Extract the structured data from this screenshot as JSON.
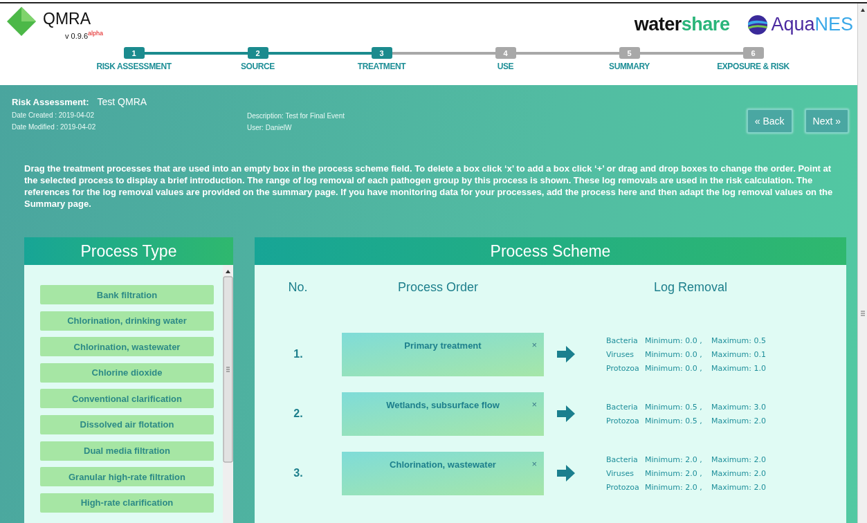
{
  "app": {
    "name": "QMRA",
    "version": "v 0.9.6",
    "version_tag": "alpha"
  },
  "partner_logos": [
    {
      "kind": "watershare",
      "parts": [
        "water",
        "share"
      ]
    },
    {
      "kind": "aquanes",
      "parts": [
        "Aqua",
        "NES"
      ]
    }
  ],
  "steps": [
    {
      "number": "1",
      "label": "RISK ASSESSMENT",
      "done": true
    },
    {
      "number": "2",
      "label": "SOURCE",
      "done": true
    },
    {
      "number": "3",
      "label": "TREATMENT",
      "done": true
    },
    {
      "number": "4",
      "label": "USE",
      "done": false
    },
    {
      "number": "5",
      "label": "SUMMARY",
      "done": false
    },
    {
      "number": "6",
      "label": "EXPOSURE & RISK",
      "done": false
    }
  ],
  "assessment": {
    "label": "Risk Assessment:",
    "name": "Test QMRA",
    "date_created": "Date Created : 2019-04-02",
    "date_modified": "Date Modified : 2019-04-02",
    "description": "Description: Test for Final Event",
    "user": "User: DanielW"
  },
  "nav_buttons": [
    "« Back",
    "Next »"
  ],
  "instructions": "Drag the treatment processes that are used into an empty box in the process scheme field. To delete a box click ‘x’ to add a box click ‘+’ or drag and drop boxes to change the order. Point at the selected process to display a brief introduction. The range of log removal of each pathogen group by this process is shown. These log removals are used in the risk calculation. The references for the log removal values are provided on the summary page. If you have monitoring data for your processes, add the process here and then adapt the log removal values on the Summary page.",
  "process_type": {
    "title": "Process Type",
    "items": [
      "Bank filtration",
      "Chlorination, drinking water",
      "Chlorination, wastewater",
      "Chlorine dioxide",
      "Conventional clarification",
      "Dissolved air flotation",
      "Dual media filtration",
      "Granular high-rate filtration",
      "High-rate clarification"
    ]
  },
  "process_scheme": {
    "title": "Process Scheme",
    "columns": [
      "No.",
      "Process Order",
      "Log Removal"
    ],
    "rows": [
      {
        "number": "1.",
        "process": "Primary treatment",
        "remove": "×",
        "removals": [
          {
            "pathogen": "Bacteria",
            "minimum": "Minimum: 0.0 ,",
            "maximum": "Maximum: 0.5"
          },
          {
            "pathogen": "Viruses",
            "minimum": "Minimum: 0.0 ,",
            "maximum": "Maximum: 0.1"
          },
          {
            "pathogen": "Protozoa",
            "minimum": "Minimum: 0.0 ,",
            "maximum": "Maximum: 1.0"
          }
        ]
      },
      {
        "number": "2.",
        "process": "Wetlands, subsurface flow",
        "remove": "×",
        "removals": [
          {
            "pathogen": "Bacteria",
            "minimum": "Minimum: 0.5 ,",
            "maximum": "Maximum: 3.0"
          },
          {
            "pathogen": "Protozoa",
            "minimum": "Minimum: 0.5 ,",
            "maximum": "Maximum: 2.0"
          }
        ]
      },
      {
        "number": "3.",
        "process": "Chlorination, wastewater",
        "remove": "×",
        "removals": [
          {
            "pathogen": "Bacteria",
            "minimum": "Minimum: 2.0 ,",
            "maximum": "Maximum: 2.0"
          },
          {
            "pathogen": "Viruses",
            "minimum": "Minimum: 2.0 ,",
            "maximum": "Maximum: 2.0"
          },
          {
            "pathogen": "Protozoa",
            "minimum": "Minimum: 2.0 ,",
            "maximum": "Maximum: 2.0"
          }
        ]
      }
    ]
  }
}
